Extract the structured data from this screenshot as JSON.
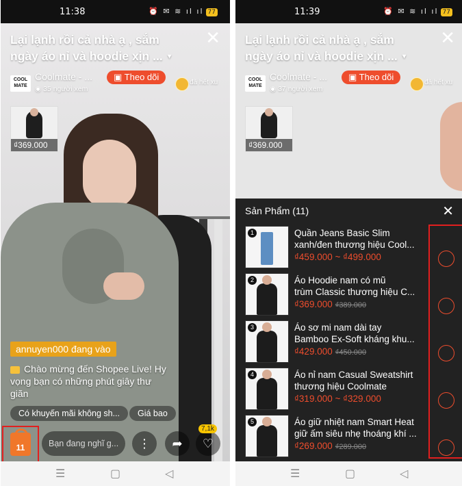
{
  "left": {
    "status": {
      "time": "11:38",
      "icons": "⏰ ✉ ≋ ıl ıl",
      "battery": "77"
    },
    "stream": {
      "title_line1": "Lại lạnh rồi cả nhà ạ , sắm",
      "title_line2": "ngày áo nỉ và hoodie xịn ...",
      "logo_text": "COOL MATE",
      "shop_name": "Coolmate - ...",
      "viewers": "35 người xem",
      "follow_label": "Theo dõi",
      "coin_label": "đã hết xu",
      "pinned_price": "₫369.000"
    },
    "chat": {
      "join_message": "annuyen000 đang vào",
      "welcome_message": "Chào mừng đến Shopee Live! Hy vọng bạn có những phút giây thư giãn"
    },
    "chips": [
      "Có khuyến mãi không sh...",
      "Giá bao"
    ],
    "bottom": {
      "bag_count": "11",
      "comment_placeholder": "Bạn đang nghĩ g...",
      "like_count": "7,1k"
    }
  },
  "right": {
    "status": {
      "time": "11:39",
      "icons": "⏰ ✉ ≋ ıl ıl",
      "battery": "77"
    },
    "stream": {
      "title_line1": "Lại lạnh rồi cả nhà ạ , sắm",
      "title_line2": "ngày áo nỉ và hoodie xịn ...",
      "logo_text": "COOL MATE",
      "shop_name": "Coolmate - ...",
      "viewers": "37 người xem",
      "follow_label": "Theo dõi",
      "coin_label": "đã hết xu",
      "pinned_price": "₫369.000"
    },
    "sheet_title": "Sản Phẩm (11)",
    "products": [
      {
        "num": "1",
        "name_line1": "Quần Jeans Basic Slim",
        "name_line2": "xanh/đen thương hiệu Cool...",
        "price": "₫459.000 ~ ₫499.000",
        "old_price": ""
      },
      {
        "num": "2",
        "name_line1": "Áo Hoodie nam có mũ",
        "name_line2": "trùm Classic thương hiệu C...",
        "price": "₫369.000",
        "old_price": "₫389.000"
      },
      {
        "num": "3",
        "name_line1": "Áo sơ mi nam dài tay",
        "name_line2": "Bamboo Ex-Soft kháng khu...",
        "price": "₫429.000",
        "old_price": "₫450.000"
      },
      {
        "num": "4",
        "name_line1": "Áo nỉ nam Casual Sweatshirt",
        "name_line2": "thương hiệu Coolmate",
        "price": "₫319.000 ~ ₫329.000",
        "old_price": ""
      },
      {
        "num": "5",
        "name_line1": "Áo giữ nhiệt nam Smart Heat",
        "name_line2": "giữ ấm siêu nhẹ thoáng khí ...",
        "price": "₫269.000",
        "old_price": "₫289.000"
      }
    ]
  },
  "colors": {
    "accent": "#ee4d2d",
    "join_bg": "#e8a21a",
    "highlight_box": "#e21f1f"
  }
}
